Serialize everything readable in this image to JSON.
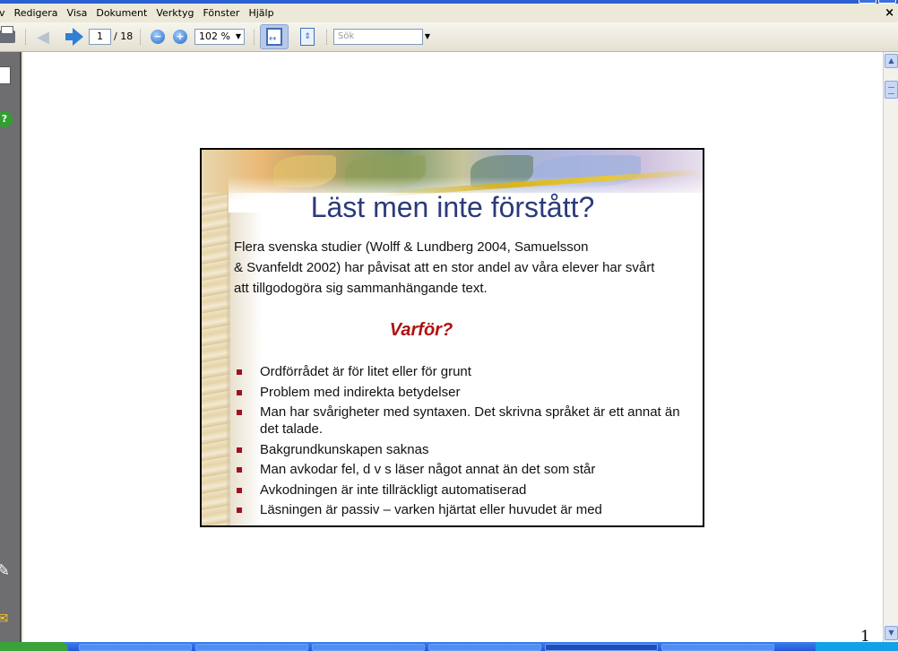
{
  "menu": {
    "items": [
      "iv",
      "Redigera",
      "Visa",
      "Dokument",
      "Verktyg",
      "Fönster",
      "Hjälp"
    ],
    "close_label": "×"
  },
  "toolbar": {
    "current_page": "1",
    "total_pages": "/ 18",
    "zoom_value": "102 %",
    "search_placeholder": "Sök"
  },
  "icons": {
    "print": "printer-icon",
    "prev": "arrow-left-icon",
    "next": "arrow-right-icon",
    "zoom_out": "zoom-out-icon",
    "zoom_in": "zoom-in-icon",
    "fit_width": "fit-width-icon",
    "fit_page": "fit-page-icon",
    "pages": "pages-panel-icon",
    "help": "help-icon",
    "attachments": "paperclip-icon",
    "comments": "comments-icon"
  },
  "slide": {
    "title": "Läst men inte förstått?",
    "intro_lines": [
      "Flera svenska studier (Wolff & Lundberg 2004, Samuelsson",
      "& Svanfeldt 2002) har påvisat att en stor andel av våra elever har svårt",
      "att tillgodogöra sig sammanhängande text."
    ],
    "subheading": "Varför?",
    "bullets": [
      "Ordförrådet är för litet eller för grunt",
      "Problem med indirekta betydelser",
      "Man har svårigheter med syntaxen. Det skrivna språket är ett annat än det talade.",
      "Bakgrundkunskapen saknas",
      "Man avkodar fel, d v s läser något annat än det som står",
      "Avkodningen är inte tillräckligt automatiserad",
      "Läsningen är passiv – varken hjärtat eller huvudet är med"
    ]
  },
  "page_number": "1",
  "colors": {
    "title": "#2b3a7a",
    "subheading": "#b01010",
    "bullet": "#a01020",
    "menubar": "#ece9d8"
  }
}
